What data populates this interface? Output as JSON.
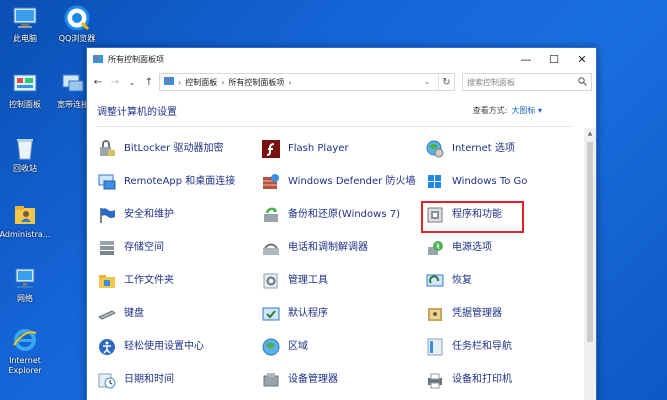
{
  "desktop": {
    "icons": [
      {
        "label": "此电脑",
        "icon": "computer-icon"
      },
      {
        "label": "QQ浏览器",
        "icon": "qq-browser-icon"
      },
      {
        "label": "控制面板",
        "icon": "control-panel-icon"
      },
      {
        "label": "宽带连接",
        "icon": "broadband-icon"
      },
      {
        "label": "回收站",
        "icon": "recycle-bin-icon"
      },
      {
        "label": "Administra...",
        "icon": "user-folder-icon"
      },
      {
        "label": "网络",
        "icon": "network-icon"
      },
      {
        "label": "Internet Explorer",
        "icon": "ie-icon"
      }
    ]
  },
  "window": {
    "title": "所有控制面板项",
    "minimize": "—",
    "maximize": "☐",
    "close": "✕"
  },
  "address": {
    "back": "←",
    "forward": "→",
    "recent": "⌄",
    "up": "↑",
    "crumbs": [
      "控制面板",
      "所有控制面板项"
    ],
    "dropdown": "⌄",
    "refresh": "↻",
    "search_placeholder": "搜索控制面板"
  },
  "main": {
    "heading": "调整计算机的设置",
    "view_by_label": "查看方式:",
    "view_by_value": "大图标 ▾"
  },
  "items": [
    {
      "label": "BitLocker 驱动器加密",
      "icon": "bitlocker-icon"
    },
    {
      "label": "Flash Player",
      "icon": "flash-icon"
    },
    {
      "label": "Internet 选项",
      "icon": "internet-options-icon"
    },
    {
      "label": "RemoteApp 和桌面连接",
      "icon": "remoteapp-icon"
    },
    {
      "label": "Windows Defender 防火墙",
      "icon": "firewall-icon"
    },
    {
      "label": "Windows To Go",
      "icon": "windows-to-go-icon"
    },
    {
      "label": "安全和维护",
      "icon": "security-flag-icon"
    },
    {
      "label": "备份和还原(Windows 7)",
      "icon": "backup-icon"
    },
    {
      "label": "程序和功能",
      "icon": "programs-icon"
    },
    {
      "label": "存储空间",
      "icon": "storage-icon"
    },
    {
      "label": "电话和调制解调器",
      "icon": "phone-modem-icon"
    },
    {
      "label": "电源选项",
      "icon": "power-icon"
    },
    {
      "label": "工作文件夹",
      "icon": "work-folder-icon"
    },
    {
      "label": "管理工具",
      "icon": "admin-tools-icon"
    },
    {
      "label": "恢复",
      "icon": "recovery-icon"
    },
    {
      "label": "键盘",
      "icon": "keyboard-icon"
    },
    {
      "label": "默认程序",
      "icon": "default-programs-icon"
    },
    {
      "label": "凭据管理器",
      "icon": "credential-icon"
    },
    {
      "label": "轻松使用设置中心",
      "icon": "ease-of-access-icon"
    },
    {
      "label": "区域",
      "icon": "region-icon"
    },
    {
      "label": "任务栏和导航",
      "icon": "taskbar-icon"
    },
    {
      "label": "日期和时间",
      "icon": "datetime-icon"
    },
    {
      "label": "设备管理器",
      "icon": "device-manager-icon"
    },
    {
      "label": "设备和打印机",
      "icon": "printer-icon"
    }
  ],
  "colors": {
    "link": "#1e3287",
    "highlight": "#e0242c",
    "accent": "#1565c0"
  }
}
